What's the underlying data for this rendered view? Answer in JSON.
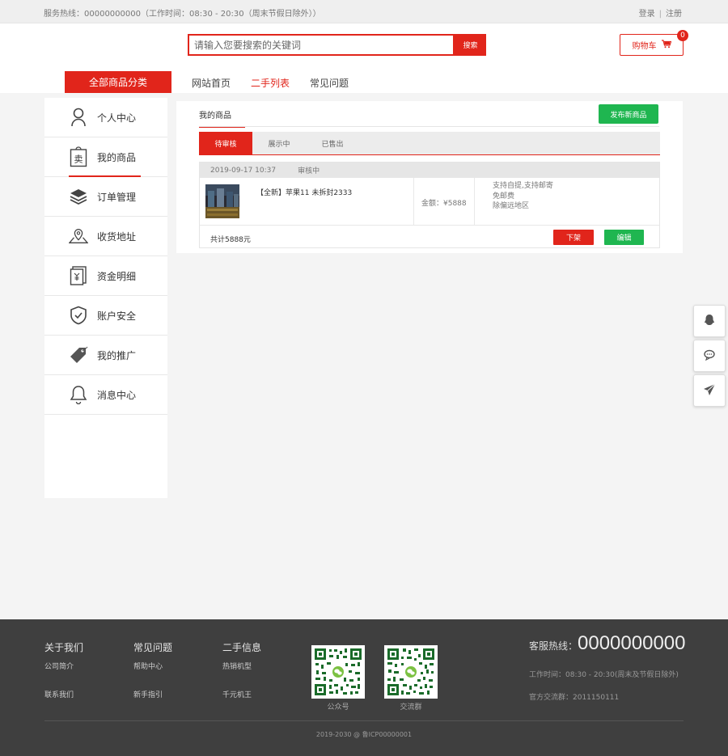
{
  "topbar": {
    "hotline": "服务热线：00000000000（工作时间：08:30 - 20:30（周末节假日除外））",
    "login": "登录",
    "sep": "|",
    "register": "注册"
  },
  "header": {
    "search_placeholder": "请输入您要搜索的关键词",
    "search_button": "搜索",
    "cart_label": "购物车",
    "cart_count": "0",
    "category_button": "全部商品分类",
    "nav": [
      "网站首页",
      "二手列表",
      "常见问题"
    ],
    "active_nav": "二手列表"
  },
  "sidebar": {
    "items": [
      {
        "label": "个人中心",
        "icon": "user-icon"
      },
      {
        "label": "我的商品",
        "icon": "sell-tag-icon"
      },
      {
        "label": "订单管理",
        "icon": "layers-icon"
      },
      {
        "label": "收货地址",
        "icon": "map-pin-icon"
      },
      {
        "label": "资金明细",
        "icon": "ledger-icon"
      },
      {
        "label": "账户安全",
        "icon": "shield-icon"
      },
      {
        "label": "我的推广",
        "icon": "tag-icon"
      },
      {
        "label": "消息中心",
        "icon": "bell-icon"
      }
    ],
    "active_index": 1,
    "sell_glyph": "卖"
  },
  "main": {
    "tab": "我的商品",
    "publish_button": "发布新商品",
    "status_tabs": [
      "待审核",
      "展示中",
      "已售出"
    ],
    "active_status": "待审核",
    "order": {
      "date": "2019-09-17 10:37",
      "status": "审核中",
      "product_title": "【全新】苹果11 未拆封2333",
      "amount": "金额：¥5888",
      "shipping": [
        "支持自提,支持邮寄",
        "免邮费",
        "除偏远地区"
      ],
      "total": "共计5888元",
      "off_button": "下架",
      "edit_button": "编辑"
    }
  },
  "float_buttons": [
    "qq-icon",
    "chat-icon",
    "send-icon"
  ],
  "footer": {
    "columns": [
      {
        "title": "关于我们",
        "items": [
          "公司简介",
          "联系我们"
        ]
      },
      {
        "title": "常见问题",
        "items": [
          "帮助中心",
          "新手指引"
        ]
      },
      {
        "title": "二手信息",
        "items": [
          "热销机型",
          "千元机王"
        ]
      }
    ],
    "qr_codes": [
      "公众号",
      "交流群"
    ],
    "hotline_label": "客服热线：",
    "hotline_number": "0000000000",
    "work_time": "工作时间：08:30 - 20:30(周末及节假日除外)",
    "group": "官方交流群：2011150111",
    "copyright": "2019-2030 @ 鲁ICP00000001"
  },
  "colors": {
    "accent": "#e1251b",
    "green": "#1fb650",
    "footer_bg": "#3f3f3f"
  }
}
